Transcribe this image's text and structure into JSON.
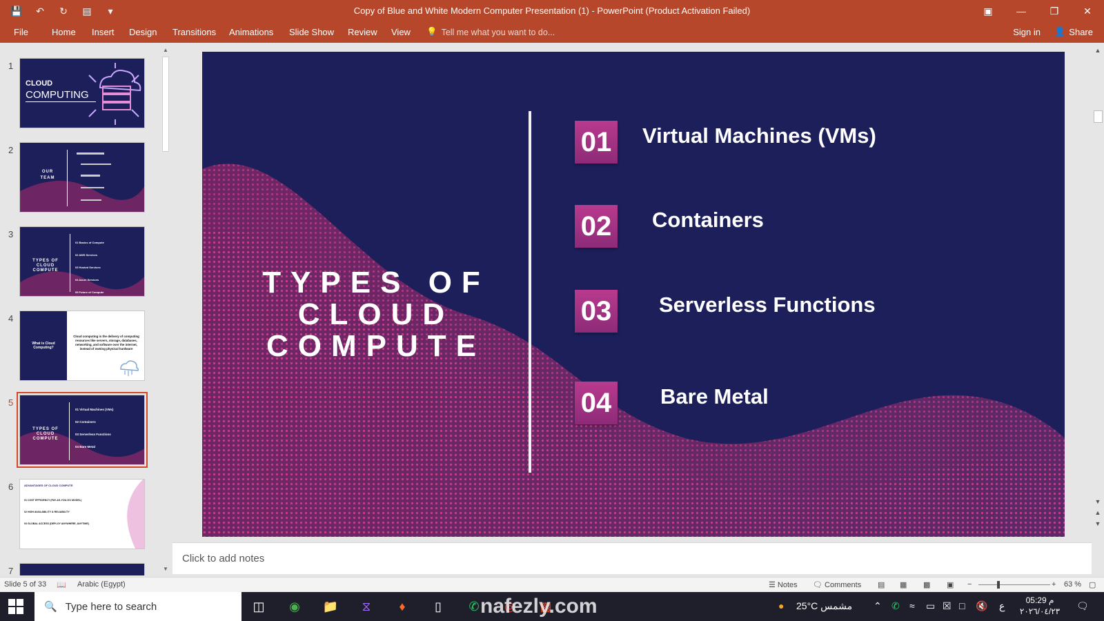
{
  "window": {
    "title": "Copy of Blue and White Modern Computer Presentation (1) - PowerPoint (Product Activation Failed)"
  },
  "ribbon": {
    "tabs": [
      "File",
      "Home",
      "Insert",
      "Design",
      "Transitions",
      "Animations",
      "Slide Show",
      "Review",
      "View"
    ],
    "tell_me": "Tell me what you want to do...",
    "sign_in": "Sign in",
    "share": "Share"
  },
  "thumbnails": [
    {
      "num": "1",
      "title_line1": "CLOUD",
      "title_line2": "COMPUTING"
    },
    {
      "num": "2",
      "title_line1": "OUR",
      "title_line2": "TEAM"
    },
    {
      "num": "3",
      "title_line1": "TYPES OF",
      "title_line2": "CLOUD",
      "title_line3": "COMPUTE",
      "items": [
        "01 Basics of Compute",
        "02 AWS Services",
        "03 Hosted Services",
        "04 Azure Services",
        "05 Future of Compute"
      ]
    },
    {
      "num": "4",
      "left_text": "What is Cloud Computing?",
      "body": "Cloud computing is the delivery of computing resources like servers, storage, databases, networking, and software over the internet, instead of owning physical hardware"
    },
    {
      "num": "5",
      "title_line1": "TYPES OF",
      "title_line2": "CLOUD",
      "title_line3": "COMPUTE",
      "items": [
        "01 Virtual Machines (VMs)",
        "02 Containers",
        "03 Serverless Functions",
        "04 Bare Metal"
      ]
    },
    {
      "num": "6",
      "header": "ADVANTAGES OF CLOUD COMPUTE",
      "items": [
        "01 COST EFFICIENCY (PAY-AS-YOU-GO MODEL)",
        "02 HIGH AVAILABILITY & RELIABILITY",
        "03 GLOBAL ACCESS (DEPLOY ANYWHERE, ANYTIME)"
      ]
    },
    {
      "num": "7"
    }
  ],
  "slide": {
    "title": "TYPES OF CLOUD COMPUTE",
    "items": [
      {
        "num": "01",
        "label": "Virtual Machines (VMs)"
      },
      {
        "num": "02",
        "label": "Containers"
      },
      {
        "num": "03",
        "label": "Serverless Functions"
      },
      {
        "num": "04",
        "label": "Bare Metal"
      }
    ]
  },
  "notes_placeholder": "Click to add notes",
  "status": {
    "slide_counter": "Slide 5 of 33",
    "language": "Arabic (Egypt)",
    "notes": "Notes",
    "comments": "Comments",
    "zoom": "63 %"
  },
  "watermark": "nafezly.com",
  "taskbar": {
    "search_placeholder": "Type here to search",
    "weather": "25°C مشمس",
    "language": "ع",
    "time": "05:29 م",
    "date": "٢٠٢٦/٠٤/٢٣"
  }
}
